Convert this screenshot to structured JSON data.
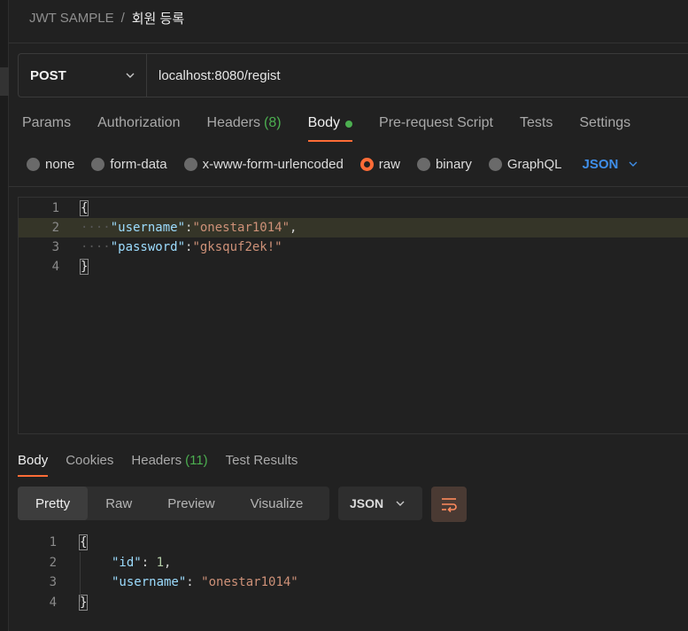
{
  "breadcrumb": {
    "collection": "JWT SAMPLE",
    "separator": "/",
    "request_name": "회원 등록"
  },
  "request": {
    "method": "POST",
    "url": "localhost:8080/regist"
  },
  "tabs": [
    {
      "label": "Params"
    },
    {
      "label": "Authorization"
    },
    {
      "label": "Headers",
      "count": "(8)"
    },
    {
      "label": "Body",
      "active": true
    },
    {
      "label": "Pre-request Script"
    },
    {
      "label": "Tests"
    },
    {
      "label": "Settings"
    }
  ],
  "body_types": [
    "none",
    "form-data",
    "x-www-form-urlencoded",
    "raw",
    "binary",
    "GraphQL"
  ],
  "body_type_selected": "raw",
  "raw_format": "JSON",
  "request_body": {
    "line_numbers": [
      "1",
      "2",
      "3",
      "4"
    ],
    "open_brace": "{",
    "close_brace": "}",
    "indent_marks_2": "····",
    "indent_marks_3": "····",
    "key_username": "\"username\"",
    "value_username": "\"onestar1014\"",
    "key_password": "\"password\"",
    "value_password": "\"gksquf2ek!\"",
    "colon": ":",
    "comma": ","
  },
  "response_tabs": {
    "body": "Body",
    "cookies": "Cookies",
    "headers": "Headers",
    "headers_count": "(11)",
    "test_results": "Test Results"
  },
  "view_modes": {
    "pretty": "Pretty",
    "raw": "Raw",
    "preview": "Preview",
    "visualize": "Visualize"
  },
  "response_format": "JSON",
  "response_body": {
    "line_numbers": [
      "1",
      "2",
      "3",
      "4"
    ],
    "open_brace": "{",
    "close_brace": "}",
    "key_id": "\"id\"",
    "value_id": "1",
    "key_username": "\"username\"",
    "value_username": "\"onestar1014\"",
    "colon": ": ",
    "comma": ","
  },
  "colors": {
    "accent": "#ff6c37",
    "success": "#4caf50",
    "link_blue": "#3f8ee8"
  }
}
